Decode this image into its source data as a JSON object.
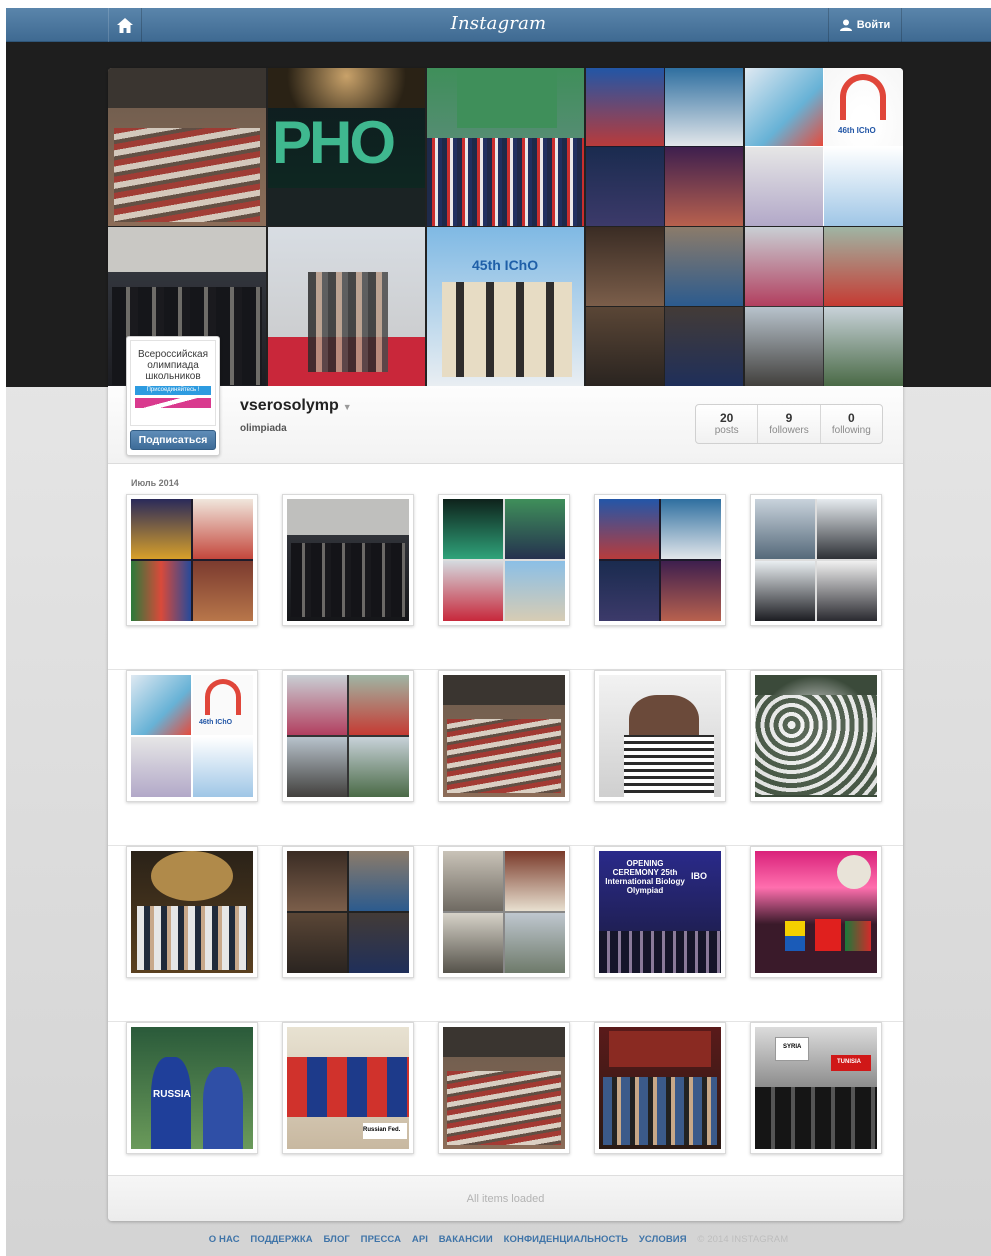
{
  "nav": {
    "brand": "Instagram",
    "login_label": "Войти"
  },
  "profile": {
    "avatar_text": "Всероссийская олимпиада школьников",
    "avatar_join": "Присоединяйтесь !",
    "follow_label": "Подписаться",
    "username": "vserosolymp",
    "full_name": "olimpiada",
    "stats": [
      {
        "num": "20",
        "label": "posts"
      },
      {
        "num": "9",
        "label": "followers"
      },
      {
        "num": "0",
        "label": "following"
      }
    ]
  },
  "feed": {
    "month": "Июль 2014",
    "loaded_text": "All items loaded"
  },
  "footer": {
    "links": [
      "О НАС",
      "ПОДДЕРЖКА",
      "БЛОГ",
      "ПРЕССА",
      "API",
      "ВАКАНСИИ",
      "КОНФИДЕНЦИАЛЬНОСТЬ",
      "УСЛОВИЯ"
    ],
    "copyright": "© 2014 INSTAGRAM"
  },
  "colors": {
    "nav_bar": "#4a76a0",
    "link": "#3f74a8",
    "header_bg": "#1e1e1e"
  },
  "icons": [
    "home-icon",
    "user-icon",
    "dropdown-caret-icon"
  ],
  "mosaic_text": [
    "PHO",
    "45th IChO",
    "46th IChO"
  ],
  "thumb_text": [
    "46th IChO",
    "OPENING CEREMONY 25th International Biology Olympiad",
    "IBO",
    "RUSSIA",
    "Russian Fed.",
    "SYRIA",
    "TUNISIA"
  ]
}
